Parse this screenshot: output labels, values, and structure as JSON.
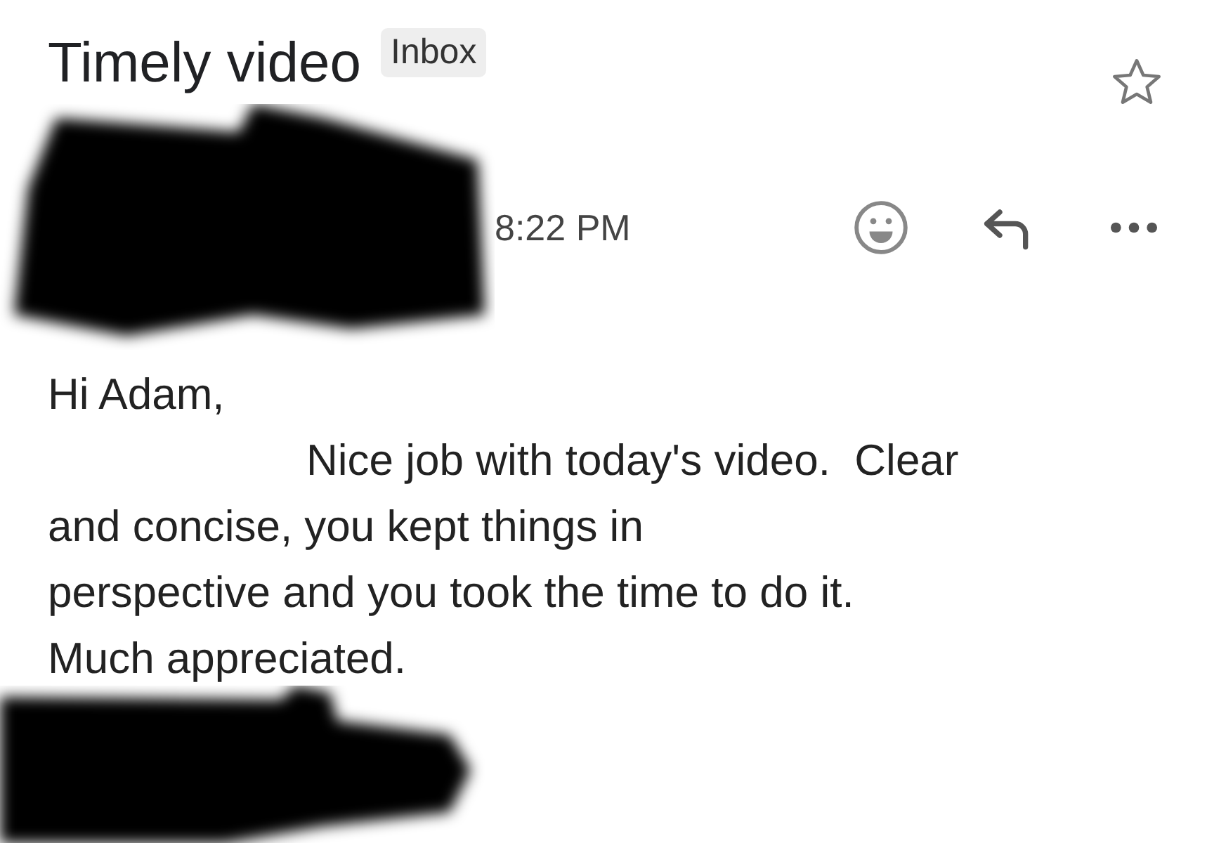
{
  "subject": "Timely video",
  "label": "Inbox",
  "starred": false,
  "time": "8:22 PM",
  "greeting": "Hi Adam,",
  "body_lines": [
    "Nice job with today's video.  Clear",
    "and concise, you kept things in",
    "perspective and you took the time to do it.",
    "Much appreciated."
  ]
}
